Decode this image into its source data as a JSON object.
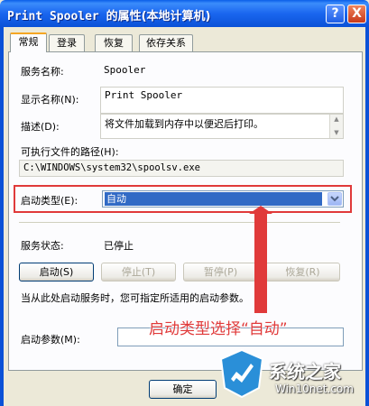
{
  "window": {
    "title_ascii": "Print Spooler",
    "title_cjk": "的属性(本地计算机)",
    "help_label": "?",
    "close_label": "X"
  },
  "tabs": [
    {
      "label": "常规",
      "active": true
    },
    {
      "label": "登录",
      "active": false
    },
    {
      "label": "恢复",
      "active": false
    },
    {
      "label": "依存关系",
      "active": false
    }
  ],
  "general": {
    "service_name_label": "服务名称:",
    "service_name_value": "Spooler",
    "display_name_label": "显示名称(N):",
    "display_name_value": "Print Spooler",
    "description_label": "描述(D):",
    "description_value": "将文件加载到内存中以便迟后打印。",
    "exec_path_label": "可执行文件的路径(H):",
    "exec_path_value": "C:\\WINDOWS\\system32\\spoolsv.exe",
    "startup_type_label": "启动类型(E):",
    "startup_type_value": "自动",
    "status_label": "服务状态:",
    "status_value": "已停止",
    "start_hint": "当从此处启动服务时，您可指定所适用的启动参数。",
    "start_params_label": "启动参数(M):",
    "start_params_value": ""
  },
  "buttons": {
    "start": "启动(S)",
    "stop": "停止(T)",
    "pause": "暂停(P)",
    "resume": "恢复(R)",
    "ok": "确定"
  },
  "annotation": {
    "text": "启动类型选择“自动”",
    "color": "#e03a3a"
  },
  "watermark": {
    "title": "系统之家",
    "site": "Win10net.com"
  }
}
